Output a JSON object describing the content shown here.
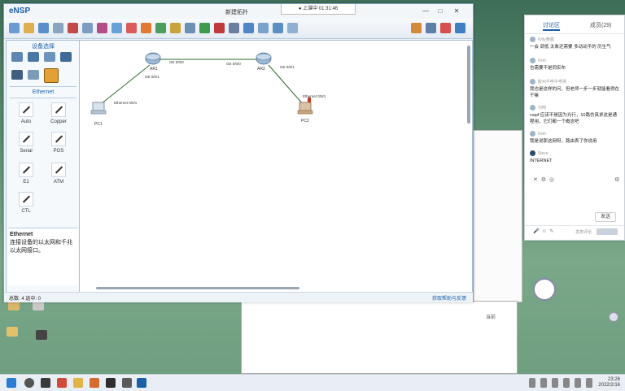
{
  "app": {
    "logo": "eNSP",
    "window_title": "新建拓扑",
    "recording": "● 上课中 01:31:46",
    "win_min": "—",
    "win_max": "□",
    "win_close": "✕"
  },
  "left_panel": {
    "title": "设备选择",
    "section_title": "Ethernet",
    "cables": [
      "Auto",
      "Copper",
      "Serial",
      "POS",
      "E1",
      "ATM",
      "CTL"
    ],
    "desc_title": "Ethernet",
    "desc_text": "连接设备的以太网和千兆以太网接口。"
  },
  "topology": {
    "nodes": [
      {
        "id": "AR1",
        "label": "AR1"
      },
      {
        "id": "AR2",
        "label": "AR2"
      },
      {
        "id": "PC1",
        "label": "PC1"
      },
      {
        "id": "PC2",
        "label": "PC2"
      }
    ],
    "ports": {
      "ar1_ge000": "GE 0/0/0",
      "ar1_ge001": "GE 0/0/1",
      "ar2_ge000": "GE 0/0/0",
      "ar2_ge001": "GE 0/0/1",
      "pc1_eth": "Ethernet 0/0/1",
      "pc2_eth": "Ethernet 0/0/1"
    }
  },
  "status": {
    "total": "总数: 4 选中: 0",
    "right": "获取帮助与反馈"
  },
  "chat": {
    "tab_active": "讨论区",
    "tab_other": "成员(29)",
    "messages": [
      {
        "who": "Kitty黄鑫",
        "text": "一会 调低 太象还需要 多动动手的    历生气"
      },
      {
        "who": "Kinh",
        "text": "也需要不是同实布"
      },
      {
        "who": "胶州牛哄牛哄哭",
        "text": "我也是这样的问，但老师一步一步就能看得在干嘛"
      },
      {
        "who": "刘明",
        "text": "cwpf 应该不是因为光行，10路仿真求这是通程用，它们都一个概念吧"
      },
      {
        "who": "Kinh",
        "text": "我是说那这网呀，路由表了你说用"
      },
      {
        "who": "Steve",
        "text": "INTERNET"
      }
    ],
    "send_label": "发送",
    "input_hint": "发表评论"
  },
  "taskbar": {
    "time": "23:26",
    "date": "2022/2/16"
  },
  "colors": {
    "accent": "#1b5fa8",
    "link_line": "#2d6b2d"
  }
}
